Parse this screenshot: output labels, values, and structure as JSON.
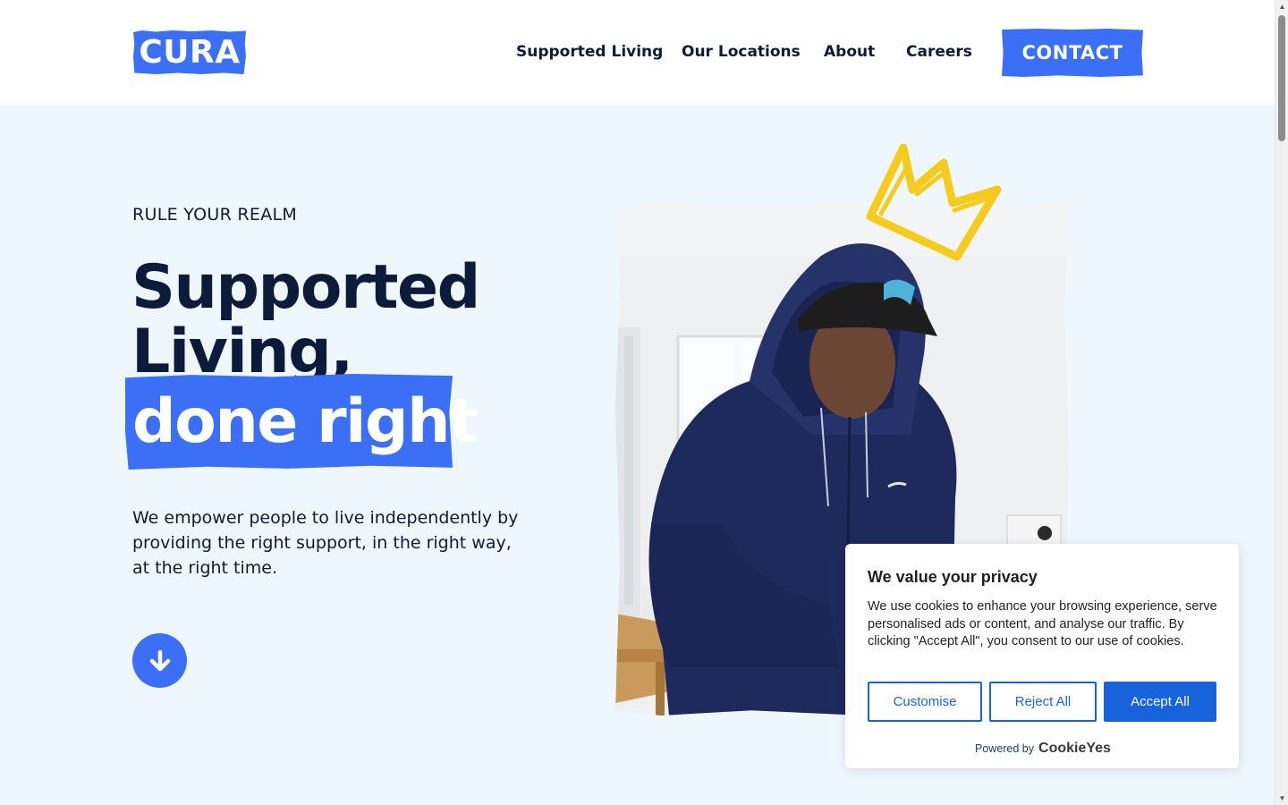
{
  "header": {
    "logo_text": "CURA",
    "nav": [
      {
        "label": "Supported Living"
      },
      {
        "label": "Our Locations"
      },
      {
        "label": "About"
      },
      {
        "label": "Careers"
      }
    ],
    "contact_label": "CONTACT"
  },
  "hero": {
    "eyebrow": "RULE YOUR REALM",
    "headline_line1": "Supported",
    "headline_line2": "Living,",
    "headline_highlight": "done right",
    "intro": "We empower people to live independently by providing the right support, in the right way, at the right time.",
    "scroll_icon": "arrow-down-icon",
    "photo_icon": "person-photo",
    "crown_icon": "crown-icon"
  },
  "cookie_banner": {
    "title": "We value your privacy",
    "text": "We use cookies to enhance your browsing experience, serve personalised ads or content, and analyse our traffic. By clicking \"Accept All\", you consent to our use of cookies.",
    "customise_label": "Customise",
    "reject_label": "Reject All",
    "accept_label": "Accept All",
    "powered_by": "Powered by",
    "brand": "CookieYes"
  },
  "colors": {
    "brand_blue": "#3b6ff5",
    "navy_text": "#0c1b3a",
    "hero_bg": "#eef7fe",
    "cookie_blue": "#1863dc",
    "crown_yellow": "#f5cc1d"
  }
}
